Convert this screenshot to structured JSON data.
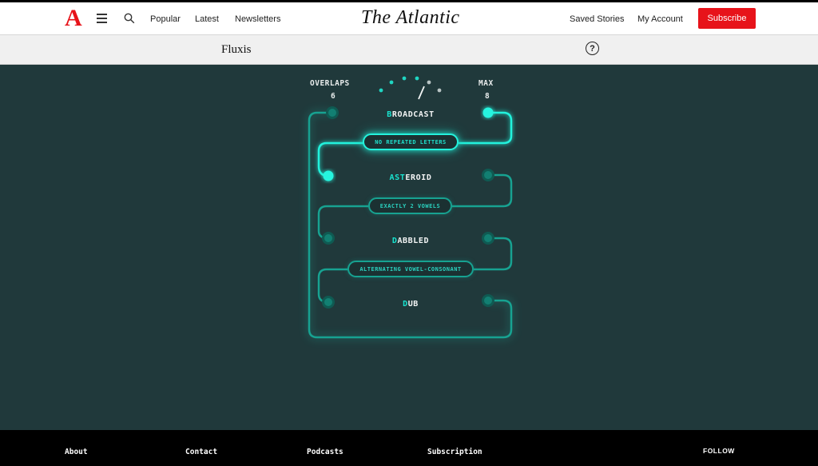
{
  "header": {
    "logo": "A",
    "nav": [
      "Popular",
      "Latest",
      "Newsletters"
    ],
    "brand": "The Atlantic",
    "saved_stories": "Saved Stories",
    "my_account": "My Account",
    "subscribe": "Subscribe"
  },
  "game": {
    "title": "Fluxis",
    "help": "?",
    "overlaps_label": "OVERLAPS",
    "overlaps_value": "6",
    "max_label": "MAX",
    "max_value": "8",
    "words": [
      {
        "highlight": "B",
        "rest": "ROADCAST"
      },
      {
        "highlight": "AST",
        "rest": "EROID"
      },
      {
        "highlight": "D",
        "rest": "ABBLED"
      },
      {
        "highlight": "D",
        "rest": "UB"
      }
    ],
    "rules": [
      {
        "label": "NO REPEATED LETTERS",
        "state": "active"
      },
      {
        "label": "EXACTLY 2 VOWELS",
        "state": "dim"
      },
      {
        "label": "ALTERNATING VOWEL-CONSONANT",
        "state": "dim"
      }
    ],
    "colors": {
      "board": "#20393b",
      "accent": "#1fe3cf",
      "dim_wire": "#127f72"
    }
  },
  "footer": {
    "links": [
      "About",
      "Contact",
      "Podcasts",
      "Subscription"
    ],
    "follow": "FOLLOW"
  }
}
